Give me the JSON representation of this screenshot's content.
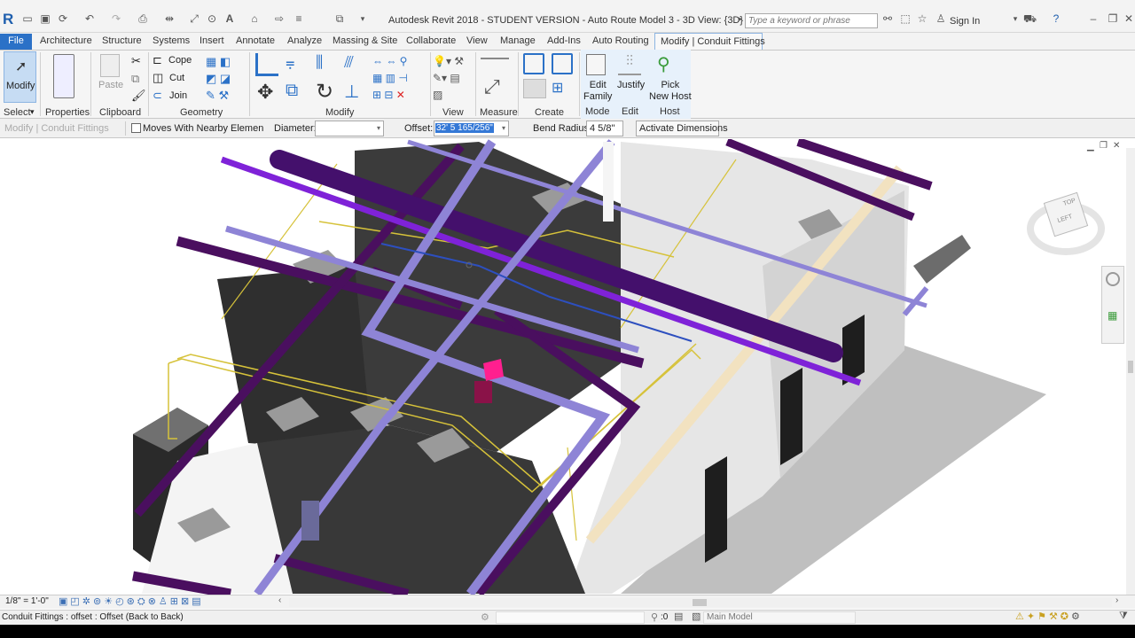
{
  "app": {
    "title": "Autodesk Revit 2018 - STUDENT VERSION -    Auto Route Model 3 - 3D View: {3D}",
    "logo": "R",
    "search_placeholder": "Type a keyword or phrase",
    "sign_in": "Sign In"
  },
  "tabs": {
    "file": "File",
    "items": [
      "Architecture",
      "Structure",
      "Systems",
      "Insert",
      "Annotate",
      "Analyze",
      "Massing & Site",
      "Collaborate",
      "View",
      "Manage",
      "Add-Ins",
      "Auto Routing"
    ],
    "contextual": "Modify | Conduit Fittings"
  },
  "ribbon": {
    "select": {
      "modify": "Modify",
      "label": "Select"
    },
    "properties": {
      "button": "Properties",
      "label": "Properties"
    },
    "clipboard": {
      "paste": "Paste",
      "label": "Clipboard"
    },
    "geometry": {
      "cope": "Cope",
      "cut": "Cut",
      "join": "Join",
      "label": "Geometry"
    },
    "modify": {
      "label": "Modify"
    },
    "view": {
      "label": "View"
    },
    "measure": {
      "label": "Measure"
    },
    "create": {
      "label": "Create"
    },
    "mode": {
      "button_line1": "Edit",
      "button_line2": "Family",
      "label": "Mode"
    },
    "edit": {
      "button": "Justify",
      "label": "Edit"
    },
    "host": {
      "button_line1": "Pick",
      "button_line2": "New Host",
      "label": "Host"
    }
  },
  "options_bar": {
    "context": "Modify | Conduit Fittings",
    "moves_with_nearby": "Moves With Nearby Elemen",
    "diameter_label": "Diameter:",
    "diameter_value": "",
    "offset_label": "Offset:",
    "offset_value": "32'  5 165/256\"",
    "bend_radius_label": "Bend Radius:",
    "bend_radius_value": "4 5/8\"",
    "activate_dimensions": "Activate Dimensions"
  },
  "viewcube": {
    "face_left": "LEFT",
    "face_top": "TOP"
  },
  "view_control_bar": {
    "scale": "1/8\" = 1'-0\""
  },
  "status_bar": {
    "message": "Conduit Fittings : offset : Offset (Back to Back)",
    "zero": ":0",
    "model": "Main Model"
  },
  "colors": {
    "file_tab": "#2b71c7",
    "pipe_purple": "#4a0f5f",
    "pipe_violet": "#7f22d8",
    "pipe_lavender": "#8e84d6",
    "conduit_yellow": "#d6c23a",
    "wall_dark": "#3a3a3a",
    "beige_beam": "#f2e2c0"
  }
}
